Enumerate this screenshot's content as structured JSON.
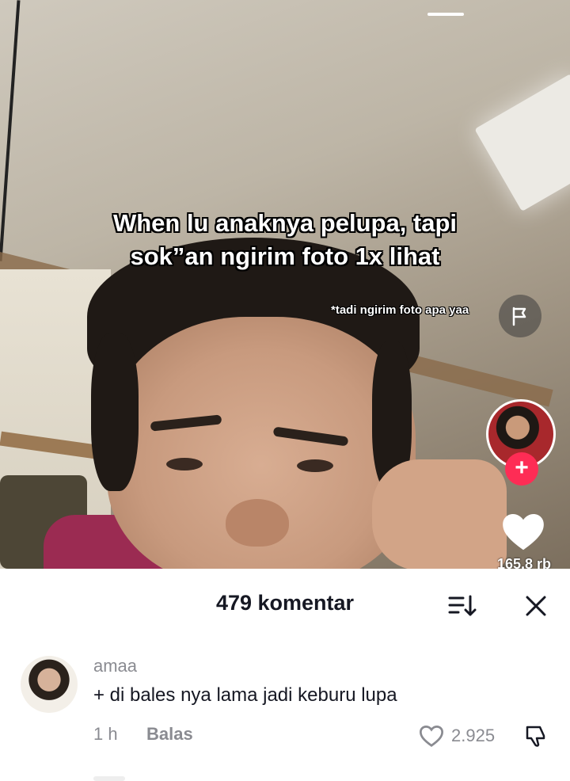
{
  "video": {
    "overlay_line1": "When lu anaknya pelupa, tapi",
    "overlay_line2": "sok”an ngirim foto 1x lihat",
    "caption_small": "*tadi ngirim foto apa yaa",
    "follow_symbol": "+",
    "like_count": "165,8 rb"
  },
  "comments_sheet": {
    "title": "479 komentar",
    "comments": [
      {
        "username": "amaa",
        "text": "+ di bales nya lama jadi keburu lupa",
        "time": "1 h",
        "reply_label": "Balas",
        "like_count": "2.925"
      }
    ]
  },
  "colors": {
    "accent": "#fe2c55",
    "text_primary": "#161823",
    "text_secondary": "#8a8b91"
  },
  "icons": [
    "flag-icon",
    "heart-icon",
    "sort-icon",
    "close-icon",
    "heart-outline-icon",
    "dislike-icon"
  ]
}
